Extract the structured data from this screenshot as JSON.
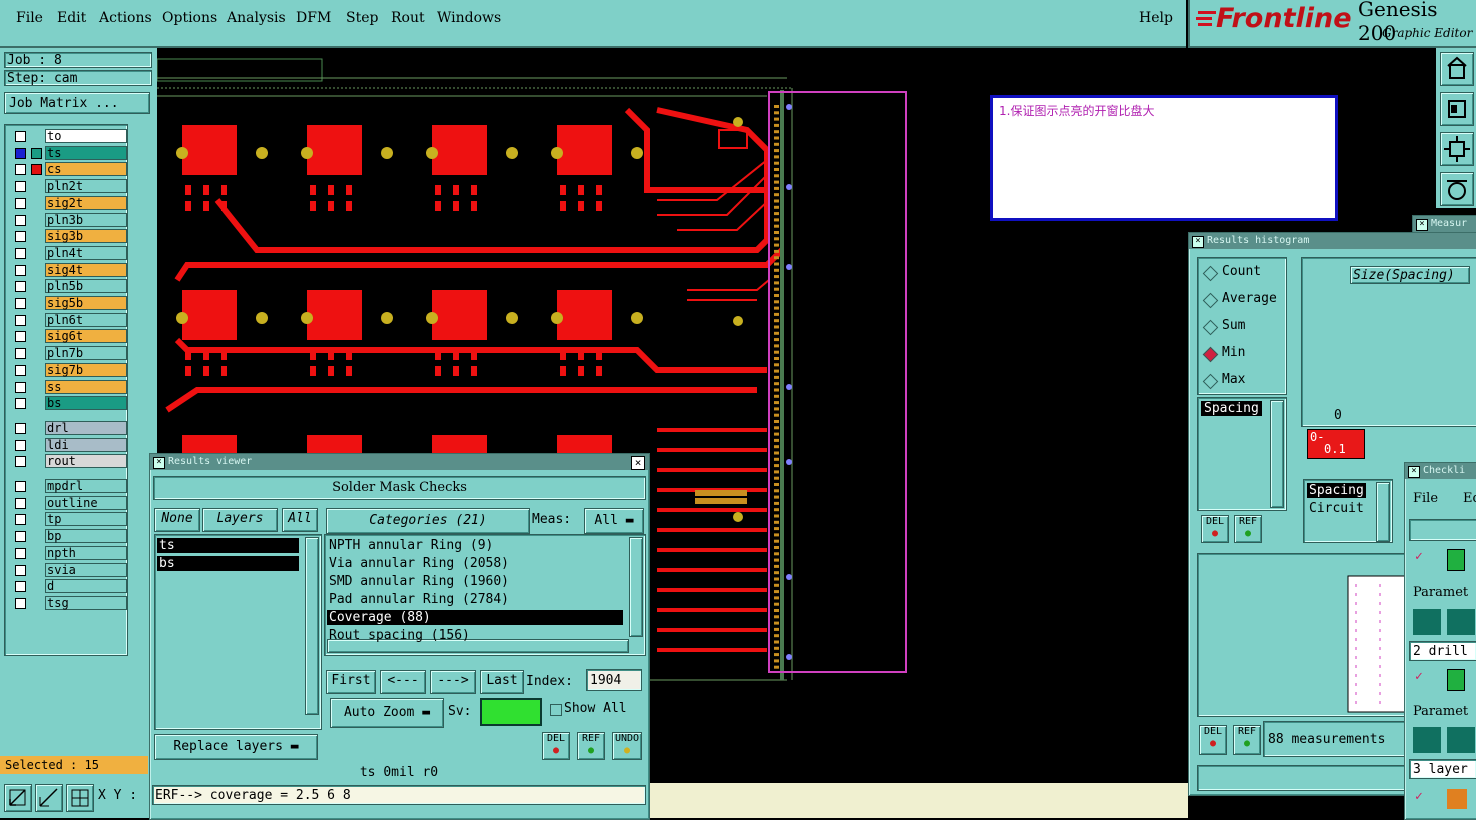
{
  "menu": {
    "items": [
      "File",
      "Edit",
      "Actions",
      "Options",
      "Analysis",
      "DFM",
      "Step",
      "Rout",
      "Windows"
    ],
    "help": "Help"
  },
  "brand": {
    "logo": "Frontline",
    "product": "Genesis 200",
    "sub": "Graphic Editor"
  },
  "job": {
    "job_label": "Job  :  8",
    "step_label": "Step:  cam",
    "matrix_button": "Job Matrix ..."
  },
  "layers": {
    "group1": [
      {
        "name": "to",
        "color": "#ffffff"
      },
      {
        "name": "ts",
        "color": "#1a9b84"
      },
      {
        "name": "cs",
        "color": "#f0b040"
      },
      {
        "name": "pln2t",
        "color": "#7fd0c8"
      },
      {
        "name": "sig2t",
        "color": "#f0b040"
      },
      {
        "name": "pln3b",
        "color": "#7fd0c8"
      },
      {
        "name": "sig3b",
        "color": "#f0b040"
      },
      {
        "name": "pln4t",
        "color": "#7fd0c8"
      },
      {
        "name": "sig4t",
        "color": "#f0b040"
      },
      {
        "name": "pln5b",
        "color": "#7fd0c8"
      },
      {
        "name": "sig5b",
        "color": "#f0b040"
      },
      {
        "name": "pln6t",
        "color": "#7fd0c8"
      },
      {
        "name": "sig6t",
        "color": "#f0b040"
      },
      {
        "name": "pln7b",
        "color": "#7fd0c8"
      },
      {
        "name": "sig7b",
        "color": "#f0b040"
      },
      {
        "name": "ss",
        "color": "#f0b040"
      },
      {
        "name": "bs",
        "color": "#1a9b84"
      }
    ],
    "group2": [
      {
        "name": "drl",
        "color": "#a8bcc8"
      },
      {
        "name": "ldi",
        "color": "#a8bcc8"
      },
      {
        "name": "rout",
        "color": "#d8d8d8"
      }
    ],
    "group3": [
      {
        "name": "mpdrl",
        "color": "#7fd0c8"
      },
      {
        "name": "outline",
        "color": "#7fd0c8"
      },
      {
        "name": "tp",
        "color": "#7fd0c8"
      },
      {
        "name": "bp",
        "color": "#7fd0c8"
      },
      {
        "name": "npth",
        "color": "#7fd0c8"
      },
      {
        "name": "svia",
        "color": "#7fd0c8"
      },
      {
        "name": "d",
        "color": "#7fd0c8"
      },
      {
        "name": "tsg",
        "color": "#7fd0c8"
      }
    ],
    "selected": "Selected : 15",
    "xy_label": "X Y :"
  },
  "note": {
    "text": "1.保证图示点亮的开窗比盘大"
  },
  "results_viewer": {
    "title": "Results viewer",
    "header": "Solder Mask Checks",
    "none_btn": "None",
    "layers_btn": "Layers",
    "all_btn": "All",
    "layer_list": [
      "ts",
      "bs"
    ],
    "categories_btn": "Categories (21)",
    "meas_label": "Meas:",
    "meas_value": "All",
    "categories": [
      {
        "label": "NPTH annular Ring (9)",
        "selected": false
      },
      {
        "label": "Via annular Ring (2058)",
        "selected": false
      },
      {
        "label": "SMD annular Ring (1960)",
        "selected": false
      },
      {
        "label": "Pad annular Ring (2784)",
        "selected": false
      },
      {
        "label": "Coverage (88)",
        "selected": true
      },
      {
        "label": "Rout spacing (156)",
        "selected": false
      }
    ],
    "first": "First",
    "prev": "<---",
    "next": "--->",
    "last": "Last",
    "index_label": "Index:",
    "index_value": "1904",
    "replace_layers": "Replace layers",
    "auto_zoom": "Auto Zoom",
    "sv_label": "Sv:",
    "show_all": "Show All",
    "del": "DEL",
    "ref": "REF",
    "undo": "UNDO",
    "status": "ts 0mil    r0",
    "erf": "ERF--> coverage = 2.5 6 8"
  },
  "histogram": {
    "title": "Results histogram",
    "options": [
      {
        "label": "Count",
        "on": false
      },
      {
        "label": "Average",
        "on": false
      },
      {
        "label": "Sum",
        "on": false
      },
      {
        "label": "Min",
        "on": true
      },
      {
        "label": "Max",
        "on": false
      }
    ],
    "size_label": "Size(Spacing)",
    "list1": [
      "Spacing"
    ],
    "axis_zero": "0",
    "bar_label_top": "0-",
    "bar_label_bot": "0.1",
    "list2": [
      "Spacing",
      "Circuit"
    ],
    "measurements": "88 measurements",
    "del": "DEL",
    "ref": "REF"
  },
  "checklist": {
    "title": "Checkli",
    "file": "File",
    "edit": "Ed",
    "param1": "Paramet",
    "row1": "2 drill",
    "param2": "Paramet",
    "row2": "3 layer"
  },
  "measure_title": "Measur"
}
